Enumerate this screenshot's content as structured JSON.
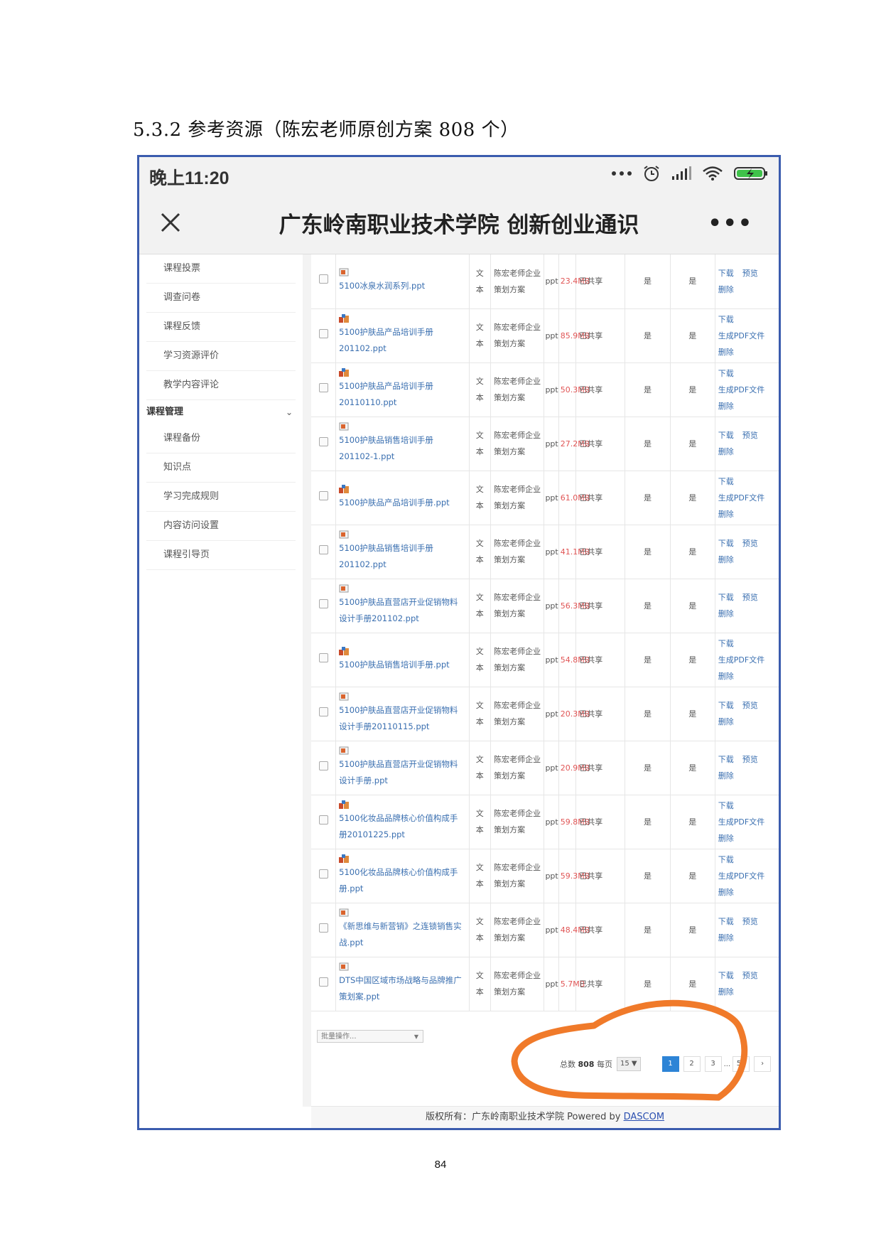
{
  "doc": {
    "heading": "5.3.2 参考资源（陈宏老师原创方案 808 个）",
    "page_number": "84"
  },
  "status_bar": {
    "time": "晚上11:20",
    "icons": [
      "more-dots-icon",
      "alarm-icon",
      "signal-icon",
      "wifi-icon",
      "battery-charging-icon"
    ]
  },
  "nav": {
    "title": "广东岭南职业技术学院 创新创业通识",
    "close_icon": "close-icon",
    "more_label": "•••"
  },
  "sidebar": {
    "items_top": [
      "课程投票",
      "调查问卷",
      "课程反馈",
      "学习资源评价",
      "教学内容评论"
    ],
    "group_label": "课程管理",
    "group_chevron": "⌄",
    "items_group": [
      "课程备份",
      "知识点",
      "学习完成规则",
      "内容访问设置",
      "课程引导页"
    ]
  },
  "files": [
    {
      "name": "5100冰泉水润系列.ppt",
      "icon": "ppt-preview-icon",
      "type": "文本",
      "source": "陈宏老师企业策划方案",
      "fmt": "ppt",
      "size": "23.4MB",
      "share": "已共享",
      "col1": "是",
      "col2": "是",
      "ops": [
        "下载",
        "预览",
        "删除"
      ]
    },
    {
      "name": "5100护肤品产品培训手册201102.ppt",
      "icon": "ppt-pdf-icon",
      "type": "文本",
      "source": "陈宏老师企业策划方案",
      "fmt": "ppt",
      "size": "85.9MB",
      "share": "已共享",
      "col1": "是",
      "col2": "是",
      "ops": [
        "下载",
        "生成PDF文件",
        "删除"
      ]
    },
    {
      "name": "5100护肤品产品培训手册20110110.ppt",
      "icon": "ppt-pdf-icon",
      "type": "文本",
      "source": "陈宏老师企业策划方案",
      "fmt": "ppt",
      "size": "50.3MB",
      "share": "已共享",
      "col1": "是",
      "col2": "是",
      "ops": [
        "下载",
        "生成PDF文件",
        "删除"
      ]
    },
    {
      "name": "5100护肤品销售培训手册201102-1.ppt",
      "icon": "ppt-preview-icon",
      "type": "文本",
      "source": "陈宏老师企业策划方案",
      "fmt": "ppt",
      "size": "27.2MB",
      "share": "已共享",
      "col1": "是",
      "col2": "是",
      "ops": [
        "下载",
        "预览",
        "删除"
      ]
    },
    {
      "name": "5100护肤品产品培训手册.ppt",
      "icon": "ppt-pdf-icon",
      "type": "文本",
      "source": "陈宏老师企业策划方案",
      "fmt": "ppt",
      "size": "61.0MB",
      "share": "已共享",
      "col1": "是",
      "col2": "是",
      "ops": [
        "下载",
        "生成PDF文件",
        "删除"
      ]
    },
    {
      "name": "5100护肤品销售培训手册201102.ppt",
      "icon": "ppt-preview-icon",
      "type": "文本",
      "source": "陈宏老师企业策划方案",
      "fmt": "ppt",
      "size": "41.1MB",
      "share": "已共享",
      "col1": "是",
      "col2": "是",
      "ops": [
        "下载",
        "预览",
        "删除"
      ]
    },
    {
      "name": "5100护肤品直营店开业促销物料设计手册201102.ppt",
      "icon": "ppt-preview-icon",
      "type": "文本",
      "source": "陈宏老师企业策划方案",
      "fmt": "ppt",
      "size": "56.3MB",
      "share": "已共享",
      "col1": "是",
      "col2": "是",
      "ops": [
        "下载",
        "预览",
        "删除"
      ]
    },
    {
      "name": "5100护肤品销售培训手册.ppt",
      "icon": "ppt-pdf-icon",
      "type": "文本",
      "source": "陈宏老师企业策划方案",
      "fmt": "ppt",
      "size": "54.8MB",
      "share": "已共享",
      "col1": "是",
      "col2": "是",
      "ops": [
        "下载",
        "生成PDF文件",
        "删除"
      ]
    },
    {
      "name": "5100护肤品直营店开业促销物料设计手册20110115.ppt",
      "icon": "ppt-preview-icon",
      "type": "文本",
      "source": "陈宏老师企业策划方案",
      "fmt": "ppt",
      "size": "20.3MB",
      "share": "已共享",
      "col1": "是",
      "col2": "是",
      "ops": [
        "下载",
        "预览",
        "删除"
      ]
    },
    {
      "name": "5100护肤品直营店开业促销物料设计手册.ppt",
      "icon": "ppt-preview-icon",
      "type": "文本",
      "source": "陈宏老师企业策划方案",
      "fmt": "ppt",
      "size": "20.9MB",
      "share": "已共享",
      "col1": "是",
      "col2": "是",
      "ops": [
        "下载",
        "预览",
        "删除"
      ]
    },
    {
      "name": "5100化妆品品牌核心价值构成手册20101225.ppt",
      "icon": "ppt-pdf-icon",
      "type": "文本",
      "source": "陈宏老师企业策划方案",
      "fmt": "ppt",
      "size": "59.8MB",
      "share": "已共享",
      "col1": "是",
      "col2": "是",
      "ops": [
        "下载",
        "生成PDF文件",
        "删除"
      ]
    },
    {
      "name": "5100化妆品品牌核心价值构成手册.ppt",
      "icon": "ppt-pdf-icon",
      "type": "文本",
      "source": "陈宏老师企业策划方案",
      "fmt": "ppt",
      "size": "59.3MB",
      "share": "已共享",
      "col1": "是",
      "col2": "是",
      "ops": [
        "下载",
        "生成PDF文件",
        "删除"
      ]
    },
    {
      "name": "《新思维与新营销》之连锁销售实战.ppt",
      "icon": "ppt-preview-icon",
      "type": "文本",
      "source": "陈宏老师企业策划方案",
      "fmt": "ppt",
      "size": "48.4MB",
      "share": "已共享",
      "col1": "是",
      "col2": "是",
      "ops": [
        "下载",
        "预览",
        "删除"
      ]
    },
    {
      "name": "DTS中国区域市场战略与品牌推广策划案.ppt",
      "icon": "ppt-preview-icon",
      "type": "文本",
      "source": "陈宏老师企业策划方案",
      "fmt": "ppt",
      "size": "5.7MB",
      "share": "已共享",
      "col1": "是",
      "col2": "是",
      "ops": [
        "下载",
        "预览",
        "删除"
      ]
    }
  ],
  "bulk": {
    "label": "批量操作...",
    "arrow": "▼"
  },
  "pager": {
    "total_label": "总数",
    "total": "808",
    "per_page_label": "每页",
    "per_page": "15 ▼",
    "pages": [
      "1",
      "2",
      "3",
      "...",
      "54",
      "›"
    ]
  },
  "footer": {
    "prefix": "版权所有：广东岭南职业技术学院 Powered by",
    "link": "DASCOM"
  },
  "colors": {
    "accent_blue": "#2d84d6",
    "link_blue": "#3a6fb0",
    "size_red": "#e05555",
    "annotation_orange": "#f07a2a",
    "frame_blue": "#3b5cae"
  }
}
